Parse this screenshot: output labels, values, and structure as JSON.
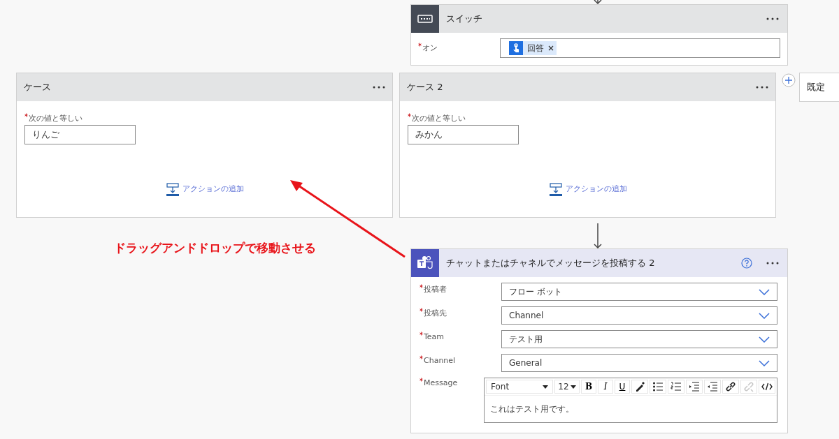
{
  "switch_action": {
    "title": "スイッチ",
    "fields": [
      {
        "label": "オン",
        "required": true,
        "token": {
          "text": "回答",
          "removable": true
        }
      }
    ]
  },
  "cases": [
    {
      "title": "ケース",
      "field_label": "次の値と等しい",
      "required": true,
      "value": "りんご",
      "add_action": "アクションの追加"
    },
    {
      "title": "ケース 2",
      "field_label": "次の値と等しい",
      "required": true,
      "value": "みかん",
      "add_action": "アクションの追加"
    }
  ],
  "default_case": {
    "title": "既定"
  },
  "annotation": {
    "text": "ドラッグアンドドロップで移動させる"
  },
  "teams_action": {
    "title": "チャットまたはチャネルでメッセージを投稿する 2",
    "fields": [
      {
        "label": "投稿者",
        "required": true,
        "value": "フロー ボット"
      },
      {
        "label": "投稿先",
        "required": true,
        "value": "Channel"
      },
      {
        "label": "Team",
        "required": true,
        "value": "テスト用"
      },
      {
        "label": "Channel",
        "required": true,
        "value": "General"
      }
    ],
    "message": {
      "label": "Message",
      "required": true,
      "font": "Font",
      "size": "12",
      "format_buttons": [
        "B",
        "I",
        "U"
      ],
      "tools": [
        {
          "kind": "pen",
          "disabled": false
        },
        {
          "kind": "bullets",
          "disabled": false
        },
        {
          "kind": "numbers",
          "disabled": false
        },
        {
          "kind": "indent",
          "disabled": false
        },
        {
          "kind": "outdent",
          "disabled": false
        },
        {
          "kind": "link",
          "disabled": false
        },
        {
          "kind": "unlink",
          "disabled": true
        },
        {
          "kind": "code",
          "disabled": false
        }
      ],
      "text": "これはテスト用です。"
    }
  }
}
